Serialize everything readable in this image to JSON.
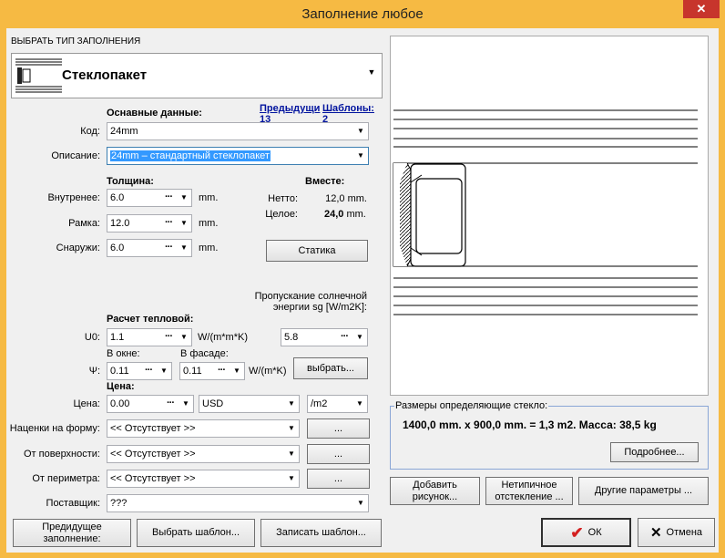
{
  "window": {
    "title": "Заполнение любое",
    "close_label": "✕"
  },
  "filling_type": {
    "label": "ВЫБРАТЬ ТИП ЗАПОЛНЕНИЯ",
    "value": "Стеклопакет"
  },
  "links": {
    "previous": "Предыдущи 13",
    "templates": "Шаблоны: 2"
  },
  "basic": {
    "heading": "Оснавные данные:",
    "code_label": "Код:",
    "code_value": "24mm",
    "desc_label": "Описание:",
    "desc_value": "24mm – стандартный стеклопакет"
  },
  "thickness": {
    "heading": "Толщина:",
    "inner_label": "Внутренее:",
    "inner_value": "6.0",
    "frame_label": "Рамка:",
    "frame_value": "12.0",
    "outer_label": "Снаружи:",
    "outer_value": "6.0",
    "unit": "mm."
  },
  "together": {
    "heading": "Вместе:",
    "net_label": "Нетто:",
    "net_value": "12,0 mm.",
    "total_label": "Целое:",
    "total_value": "24,0",
    "total_unit": "mm."
  },
  "statics_button": "Статика",
  "thermal": {
    "heading": "Расчет тепловой:",
    "u0_label": "U0:",
    "u0_value": "1.1",
    "u_unit": "W/(m*m*K)",
    "solar_label": "Пропускание солнечной энергии sg [W/m2K]:",
    "solar_value": "5.8",
    "in_window_label": "В окне:",
    "in_facade_label": "В фасаде:",
    "psi_label": "Ψ:",
    "psi_window": "0.11",
    "psi_facade": "0.11",
    "psi_unit": "W/(m*K)",
    "choose_button": "выбрать..."
  },
  "price": {
    "heading": "Цена:",
    "label": "Цена:",
    "value": "0.00",
    "currency": "USD",
    "per": "/m2"
  },
  "markups": [
    {
      "label": "Наценки на форму:",
      "value": "<< Отсутствует >>",
      "btn": "..."
    },
    {
      "label": "От поверхности:",
      "value": "<< Отсутствует >>",
      "btn": "..."
    },
    {
      "label": "От периметра:",
      "value": "<< Отсутствует >>",
      "btn": "..."
    }
  ],
  "supplier": {
    "label": "Поставщик:",
    "value": "???"
  },
  "bottom_left": {
    "prev_fill": "Предидущее заполнение:",
    "choose_tpl": "Выбрать шаблон...",
    "save_tpl": "Записать шаблон..."
  },
  "dimensions": {
    "group_label": "Размеры определяющие стекло:",
    "text": "1400,0 mm. x 900,0 mm. = 1,3 m2. Масса: 38,5 kg",
    "more_button": "Подробнее..."
  },
  "right_buttons": {
    "add_picture": "Добавить рисунок...",
    "atypical": "Нетипичное отстекление ...",
    "other_params": "Другие параметры ..."
  },
  "dialog": {
    "ok": "ОК",
    "cancel": "Отмена"
  },
  "colors": {
    "titlebar": "#f6ba43",
    "close": "#c7352c",
    "link": "#00139e",
    "ok_check": "#d42020",
    "selection": "#3399ff"
  }
}
